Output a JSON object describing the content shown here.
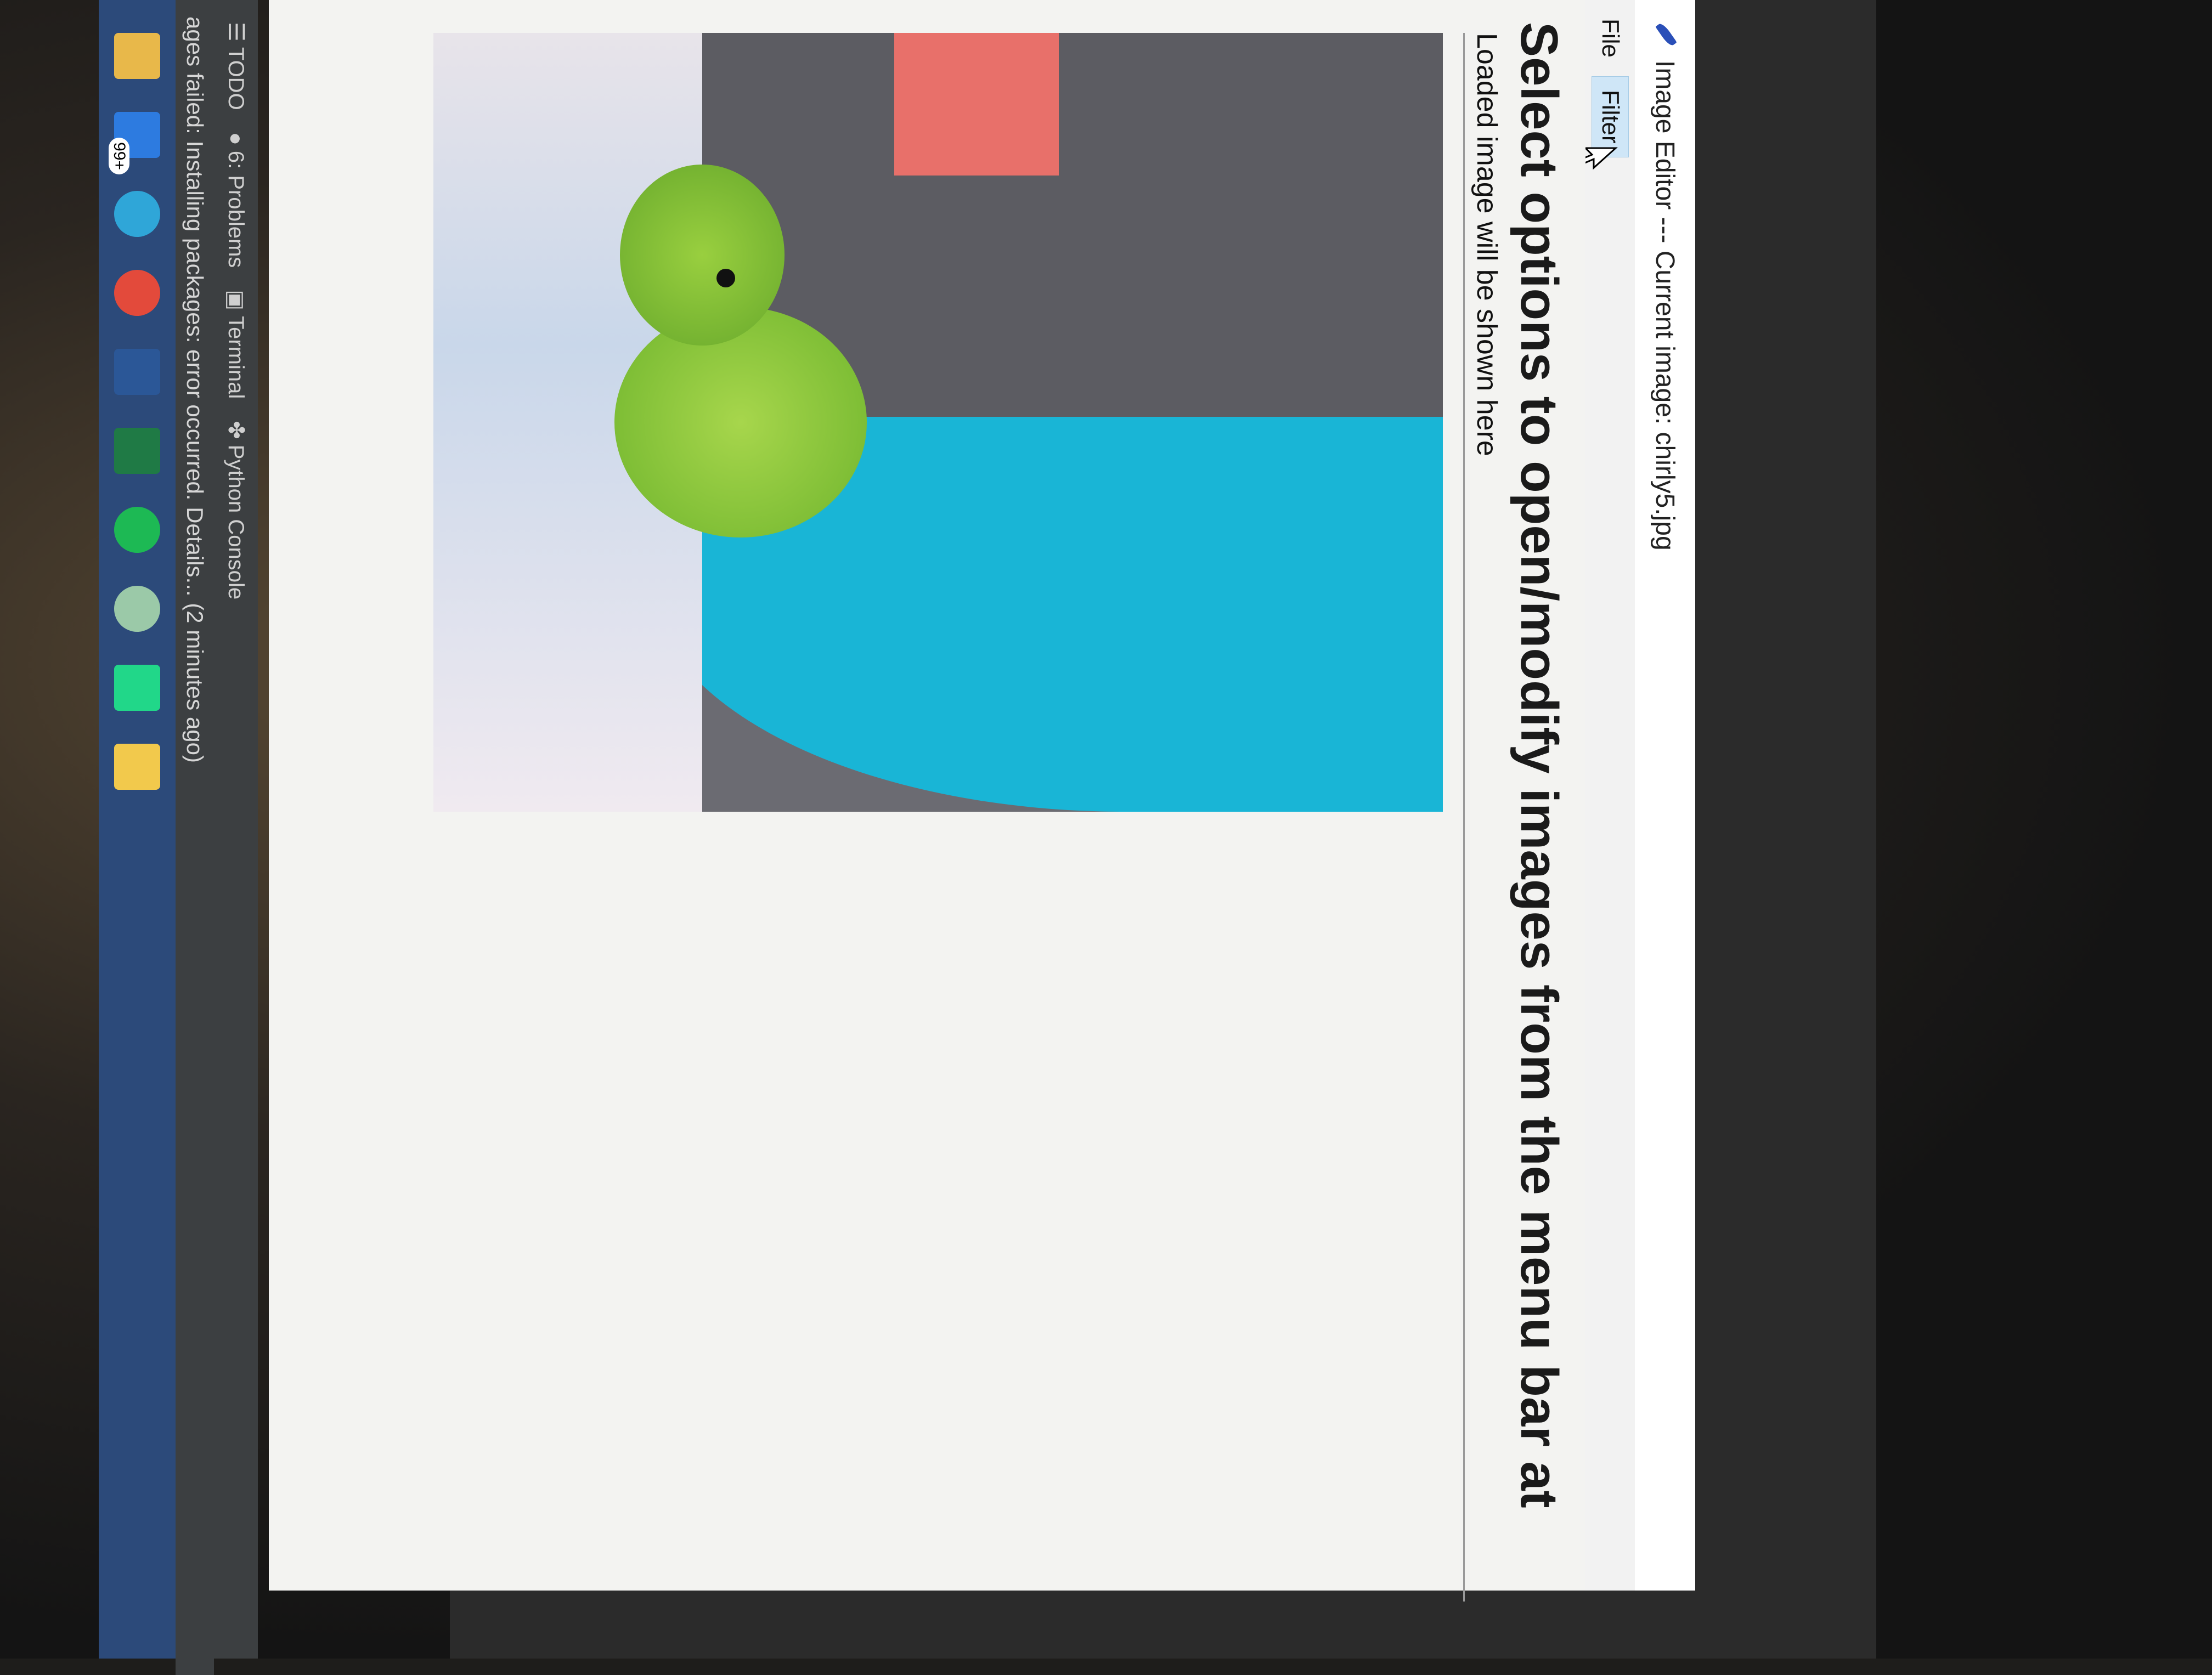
{
  "window": {
    "title": "Image Editor --- Current image: chirly5.jpg"
  },
  "menubar": {
    "items": [
      {
        "label": "File",
        "active": false
      },
      {
        "label": "Filter",
        "active": true
      }
    ]
  },
  "content": {
    "heading": "Select options to open/modify images from the menu bar at",
    "placeholder_text": "Loaded image will be shown here"
  },
  "ide": {
    "tool_tabs": [
      {
        "label": "TODO",
        "icon": "list-icon"
      },
      {
        "label": "6: Problems",
        "icon": "problems-icon"
      },
      {
        "label": "Terminal",
        "icon": "terminal-icon"
      },
      {
        "label": "Python Console",
        "icon": "python-icon"
      }
    ],
    "status_message": "ages failed: Installing packages: error occurred. Details... (2 minutes ago)"
  },
  "taskbar": {
    "items": [
      {
        "name": "file-explorer-icon",
        "color": "#e8b84a"
      },
      {
        "name": "mail-icon",
        "color": "#2d7be0",
        "badge": "99+"
      },
      {
        "name": "edge-icon",
        "color": "#2fa6d8"
      },
      {
        "name": "chrome-icon",
        "color": "#e34a3b"
      },
      {
        "name": "word-icon",
        "color": "#2b5797"
      },
      {
        "name": "excel-icon",
        "color": "#1f7a45"
      },
      {
        "name": "spotify-icon",
        "color": "#1db954"
      },
      {
        "name": "photos-icon",
        "color": "#9bc9a8"
      },
      {
        "name": "pycharm-icon",
        "color": "#21d789"
      },
      {
        "name": "python-icon",
        "color": "#f2c94c"
      }
    ]
  },
  "colors": {
    "menu_active_bg": "#cfe6f7",
    "ide_bg": "#3c3f41",
    "taskbar_bg": "#2c4a7a"
  }
}
